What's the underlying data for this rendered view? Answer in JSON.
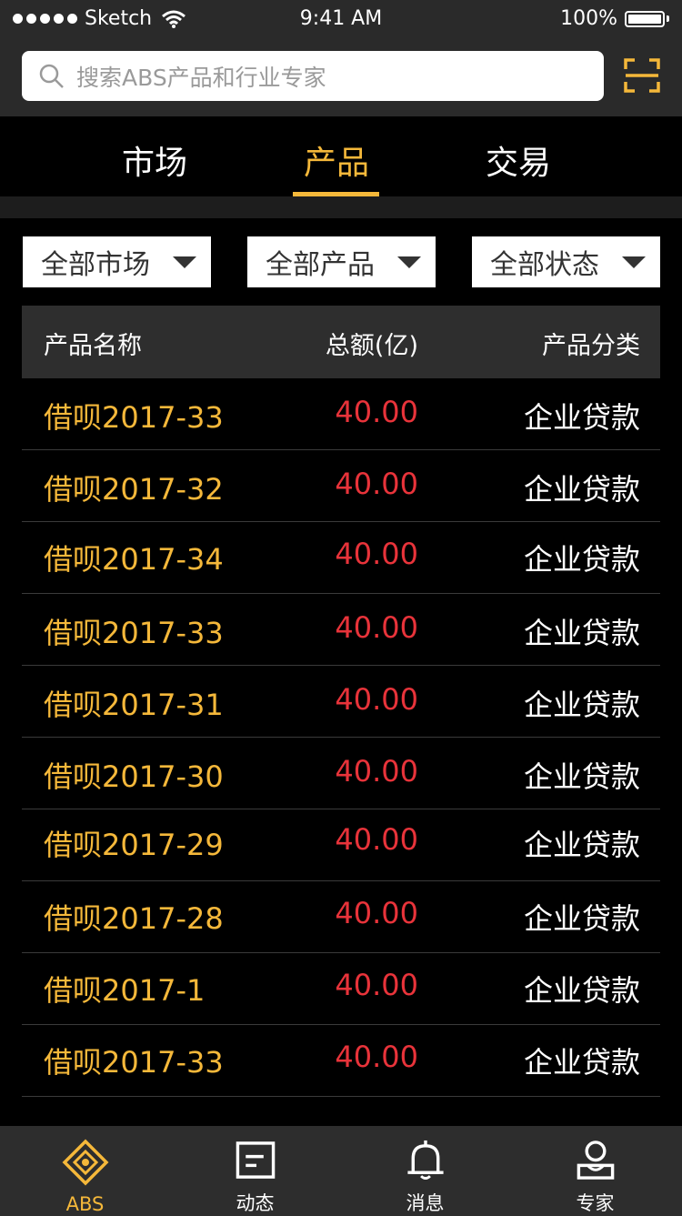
{
  "status_bar": {
    "carrier": "Sketch",
    "time": "9:41 AM",
    "battery": "100%"
  },
  "search": {
    "placeholder": "搜索ABS产品和行业专家",
    "icon": "search-icon",
    "scan_icon": "scan-icon"
  },
  "tabs": [
    {
      "label": "市场",
      "active": false
    },
    {
      "label": "产品",
      "active": true
    },
    {
      "label": "交易",
      "active": false
    }
  ],
  "filters": [
    {
      "label": "全部市场"
    },
    {
      "label": "全部产品"
    },
    {
      "label": "全部状态"
    }
  ],
  "table": {
    "headers": [
      "产品名称",
      "总额(亿)",
      "产品分类"
    ],
    "rows": [
      {
        "name": "借呗2017-33",
        "amount": "40.00",
        "category": "企业贷款"
      },
      {
        "name": "借呗2017-32",
        "amount": "40.00",
        "category": "企业贷款"
      },
      {
        "name": "借呗2017-34",
        "amount": "40.00",
        "category": "企业贷款"
      },
      {
        "name": "借呗2017-33",
        "amount": "40.00",
        "category": "企业贷款"
      },
      {
        "name": "借呗2017-31",
        "amount": "40.00",
        "category": "企业贷款"
      },
      {
        "name": "借呗2017-30",
        "amount": "40.00",
        "category": "企业贷款"
      },
      {
        "name": "借呗2017-29",
        "amount": "40.00",
        "category": "企业贷款"
      },
      {
        "name": "借呗2017-28",
        "amount": "40.00",
        "category": "企业贷款"
      },
      {
        "name": "借呗2017-1",
        "amount": "40.00",
        "category": "企业贷款"
      },
      {
        "name": "借呗2017-33",
        "amount": "40.00",
        "category": "企业贷款"
      }
    ]
  },
  "bottom_nav": [
    {
      "label": "ABS",
      "icon": "abs-logo-icon",
      "active": true
    },
    {
      "label": "动态",
      "icon": "news-icon",
      "active": false
    },
    {
      "label": "消息",
      "icon": "bell-icon",
      "active": false
    },
    {
      "label": "专家",
      "icon": "expert-icon",
      "active": false
    }
  ],
  "colors": {
    "accent": "#f5b83a",
    "amount": "#e8333a",
    "background": "#000000"
  }
}
